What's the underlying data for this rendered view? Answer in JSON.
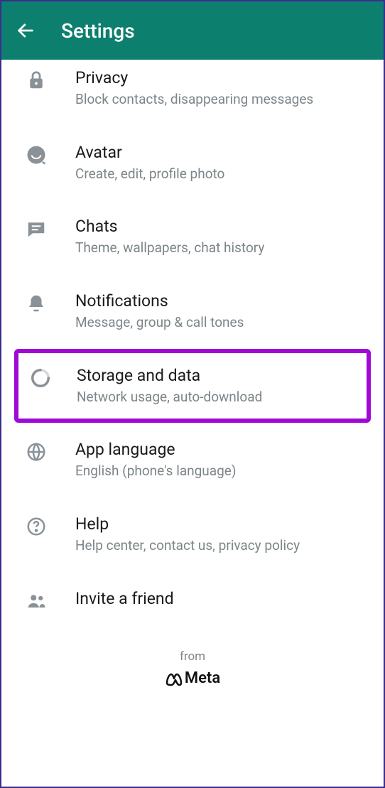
{
  "header": {
    "title": "Settings"
  },
  "items": [
    {
      "title": "Privacy",
      "sub": "Block contacts, disappearing messages"
    },
    {
      "title": "Avatar",
      "sub": "Create, edit, profile photo"
    },
    {
      "title": "Chats",
      "sub": "Theme, wallpapers, chat history"
    },
    {
      "title": "Notifications",
      "sub": "Message, group & call tones"
    },
    {
      "title": "Storage and data",
      "sub": "Network usage, auto-download"
    },
    {
      "title": "App language",
      "sub": "English (phone's language)"
    },
    {
      "title": "Help",
      "sub": "Help center, contact us, privacy policy"
    },
    {
      "title": "Invite a friend",
      "sub": ""
    }
  ],
  "footer": {
    "from": "from",
    "brand": "Meta"
  }
}
